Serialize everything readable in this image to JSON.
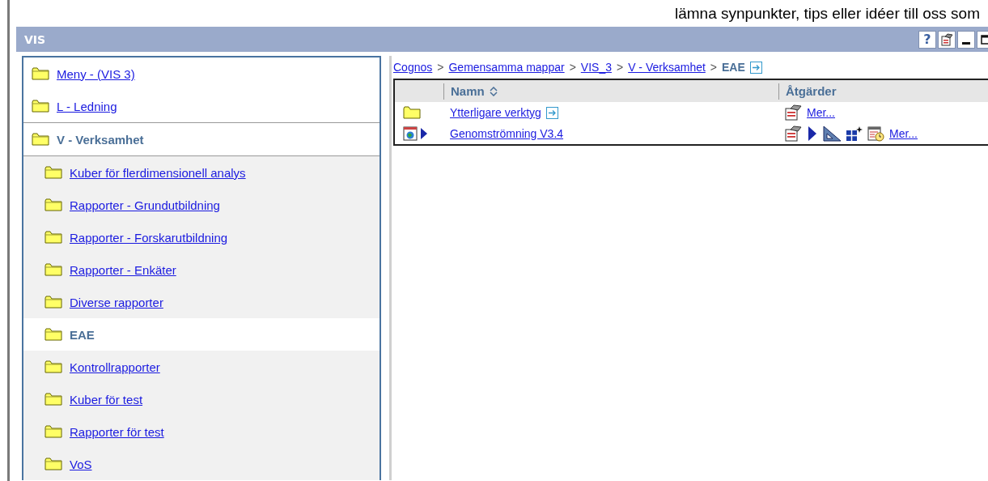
{
  "banner": {
    "text": "lämna synpunkter, tips eller idéer till oss som"
  },
  "panel": {
    "title": "VIS",
    "help_label": "?"
  },
  "nav": [
    {
      "label": "Meny - (VIS 3)",
      "selected": false
    },
    {
      "label": "L - Ledning",
      "selected": false
    },
    {
      "label": "V - Verksamhet",
      "selected": true,
      "children": [
        {
          "label": "Kuber för flerdimensionell analys",
          "selected": false
        },
        {
          "label": "Rapporter - Grundutbildning",
          "selected": false
        },
        {
          "label": "Rapporter - Forskarutbildning",
          "selected": false
        },
        {
          "label": "Rapporter - Enkäter",
          "selected": false
        },
        {
          "label": "Diverse rapporter",
          "selected": false
        },
        {
          "label": "EAE",
          "selected": true
        },
        {
          "label": "Kontrollrapporter",
          "selected": false
        },
        {
          "label": "Kuber för test",
          "selected": false
        },
        {
          "label": "Rapporter för test",
          "selected": false
        },
        {
          "label": "VoS",
          "selected": false
        }
      ]
    }
  ],
  "breadcrumb": [
    {
      "label": "Cognos",
      "current": false
    },
    {
      "label": "Gemensamma mappar",
      "current": false
    },
    {
      "label": "VIS_3",
      "current": false
    },
    {
      "label": "V - Verksamhet",
      "current": false
    },
    {
      "label": "EAE",
      "current": true
    }
  ],
  "breadcrumb_separator": ">",
  "table": {
    "columns": [
      "Namn",
      "Åtgärder"
    ],
    "rows": [
      {
        "kind": "folder",
        "name": "Ytterligare verktyg",
        "more": "Mer..."
      },
      {
        "kind": "report",
        "name": "Genomströmning V3.4",
        "more": "Mer..."
      }
    ]
  }
}
